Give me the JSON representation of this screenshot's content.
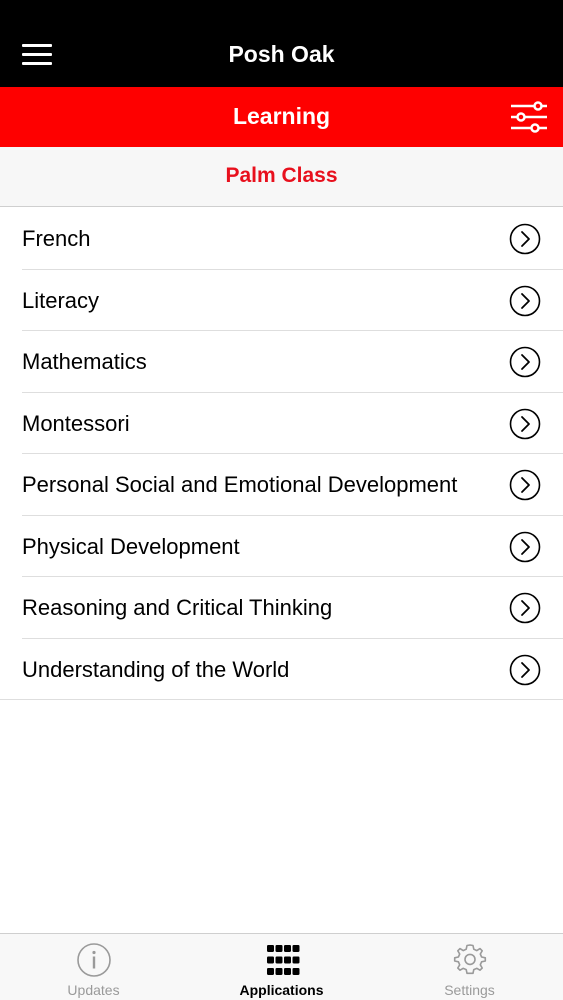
{
  "header": {
    "title": "Posh Oak",
    "menu_icon": "hamburger-menu-icon"
  },
  "section_bar": {
    "title": "Learning",
    "filter_icon": "sliders-filter-icon",
    "color": "#fe0000"
  },
  "class_bar": {
    "title": "Palm Class",
    "color": "#e8101d"
  },
  "subjects": [
    {
      "label": "French"
    },
    {
      "label": "Literacy"
    },
    {
      "label": "Mathematics"
    },
    {
      "label": "Montessori"
    },
    {
      "label": "Personal Social and Emotional Development"
    },
    {
      "label": "Physical Development"
    },
    {
      "label": "Reasoning and Critical Thinking"
    },
    {
      "label": "Understanding of the World"
    }
  ],
  "tabbar": {
    "tabs": [
      {
        "label": "Updates",
        "icon": "info-icon",
        "active": false
      },
      {
        "label": "Applications",
        "icon": "grid-icon",
        "active": true
      },
      {
        "label": "Settings",
        "icon": "gear-icon",
        "active": false
      }
    ]
  }
}
